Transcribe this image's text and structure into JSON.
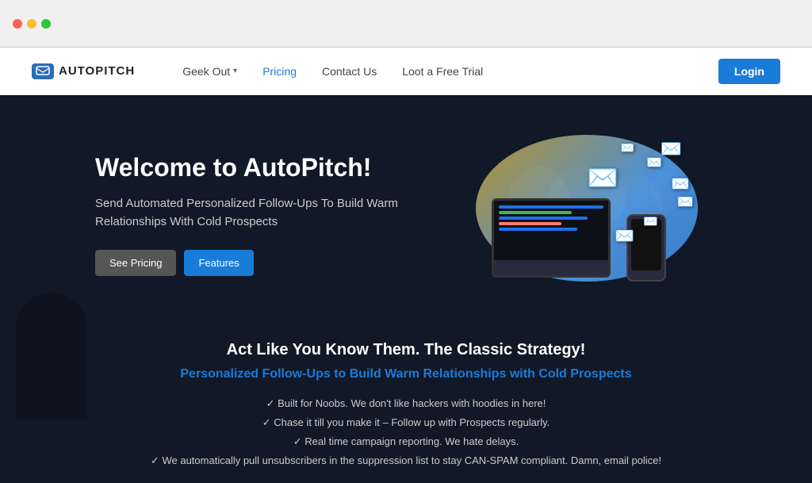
{
  "browser": {
    "traffic_lights": [
      "red",
      "yellow",
      "green"
    ]
  },
  "navbar": {
    "logo_text": "AUTOPITCH",
    "links": [
      {
        "label": "Geek Out",
        "has_dropdown": true,
        "active": false
      },
      {
        "label": "Pricing",
        "has_dropdown": false,
        "active": true
      },
      {
        "label": "Contact Us",
        "has_dropdown": false,
        "active": false
      },
      {
        "label": "Loot a Free Trial",
        "has_dropdown": false,
        "active": false
      }
    ],
    "login_label": "Login"
  },
  "hero": {
    "title": "Welcome to AutoPitch!",
    "subtitle": "Send Automated Personalized Follow-Ups To Build Warm Relationships With Cold Prospects",
    "btn_pricing": "See Pricing",
    "btn_features": "Features"
  },
  "lower": {
    "strategy_title": "Act Like You Know Them. The Classic Strategy!",
    "strategy_subtitle": "Personalized Follow-Ups to Build Warm Relationships with Cold Prospects",
    "features": [
      "✓ Built for Noobs. We don't like hackers with hoodies in here!",
      "✓ Chase it till you make it – Follow up with Prospects regularly.",
      "✓ Real time campaign reporting. We hate delays.",
      "✓ We automatically pull unsubscribers in the suppression list to stay CAN-SPAM compliant. Damn, email police!"
    ]
  }
}
